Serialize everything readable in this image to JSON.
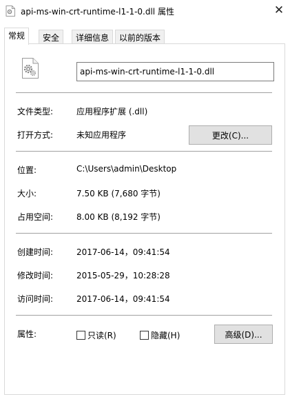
{
  "window": {
    "title": "api-ms-win-crt-runtime-l1-1-0.dll 属性",
    "close_symbol": "✕"
  },
  "tabs": [
    {
      "label": "常规"
    },
    {
      "label": "安全"
    },
    {
      "label": "详细信息"
    },
    {
      "label": "以前的版本"
    }
  ],
  "general": {
    "file_name": "api-ms-win-crt-runtime-l1-1-0.dll",
    "file_type_label": "文件类型:",
    "file_type_value": "应用程序扩展 (.dll)",
    "opens_with_label": "打开方式:",
    "opens_with_value": "未知应用程序",
    "change_button": "更改(C)...",
    "location_label": "位置:",
    "location_value": "C:\\Users\\admin\\Desktop",
    "size_label": "大小:",
    "size_value": "7.50 KB (7,680 字节)",
    "size_on_disk_label": "占用空间:",
    "size_on_disk_value": "8.00 KB (8,192 字节)",
    "created_label": "创建时间:",
    "created_value": "2017-06-14，09:41:54",
    "modified_label": "修改时间:",
    "modified_value": "2015-05-29，10:28:28",
    "accessed_label": "访问时间:",
    "accessed_value": "2017-06-14，09:41:54",
    "attributes_label": "属性:",
    "readonly_label": "只读(R)",
    "hidden_label": "隐藏(H)",
    "advanced_button": "高级(D)..."
  }
}
